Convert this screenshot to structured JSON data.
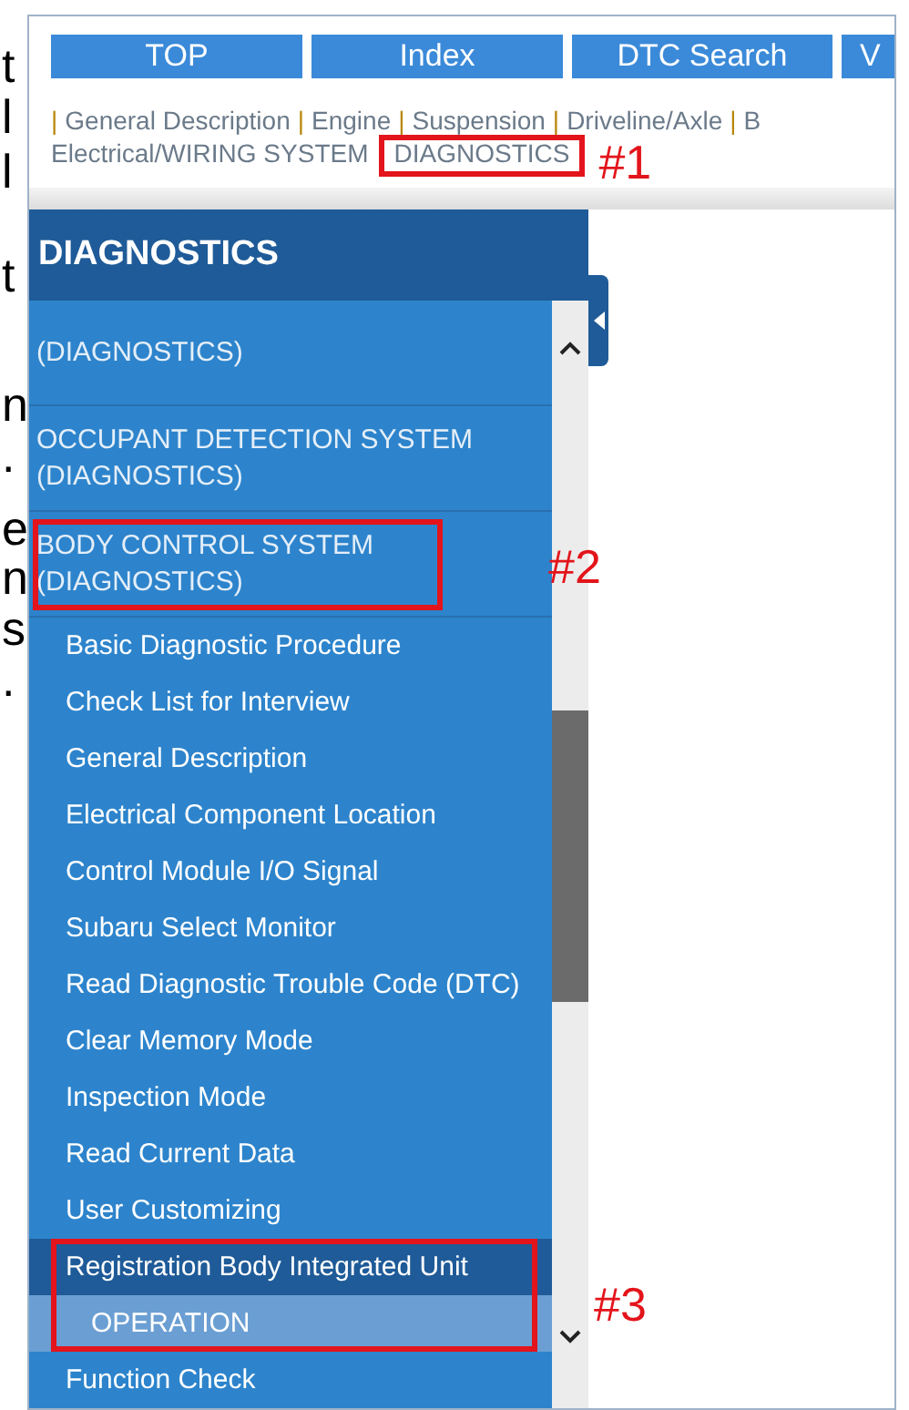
{
  "margin_text": [
    "t",
    "l",
    "l",
    "t",
    "n",
    ".",
    "e",
    "n",
    "s",
    "."
  ],
  "nav_tabs": [
    {
      "label": "TOP"
    },
    {
      "label": "Index"
    },
    {
      "label": "DTC Search"
    },
    {
      "label": "V"
    }
  ],
  "breadcrumb": {
    "lines": [
      {
        "separator": "|",
        "items": [
          {
            "label": "General Description"
          },
          {
            "label": "Engine"
          },
          {
            "label": "Suspension"
          },
          {
            "label": "Driveline/Axle"
          },
          {
            "label": "B"
          }
        ]
      },
      {
        "items": [
          {
            "label": "Electrical/WIRING SYSTEM"
          },
          {
            "label": "DIAGNOSTICS",
            "callout": "#1"
          }
        ]
      }
    ]
  },
  "sidebar": {
    "title": "DIAGNOSTICS",
    "items": [
      {
        "label": "(DIAGNOSTICS)",
        "kind": "section",
        "selected": false
      },
      {
        "label": "OCCUPANT DETECTION SYSTEM (DIAGNOSTICS)",
        "kind": "section",
        "selected": false
      },
      {
        "label": "BODY CONTROL SYSTEM (DIAGNOSTICS)",
        "kind": "section",
        "selected": false,
        "callout": "#2"
      },
      {
        "label": "Basic Diagnostic Procedure",
        "kind": "item",
        "selected": false
      },
      {
        "label": "Check List for Interview",
        "kind": "item",
        "selected": false
      },
      {
        "label": "General Description",
        "kind": "item",
        "selected": false
      },
      {
        "label": "Electrical Component Location",
        "kind": "item",
        "selected": false
      },
      {
        "label": "Control Module I/O Signal",
        "kind": "item",
        "selected": false
      },
      {
        "label": "Subaru Select Monitor",
        "kind": "item",
        "selected": false
      },
      {
        "label": "Read Diagnostic Trouble Code (DTC)",
        "kind": "item",
        "selected": false
      },
      {
        "label": "Clear Memory Mode",
        "kind": "item",
        "selected": false
      },
      {
        "label": "Inspection Mode",
        "kind": "item",
        "selected": false
      },
      {
        "label": "Read Current Data",
        "kind": "item",
        "selected": false
      },
      {
        "label": "User Customizing",
        "kind": "item",
        "selected": false
      },
      {
        "label": "Registration Body Integrated Unit",
        "kind": "group",
        "selected": false,
        "callout": "#3",
        "children": [
          {
            "label": "OPERATION",
            "kind": "subitem",
            "selected": true
          }
        ]
      },
      {
        "label": "Function Check",
        "kind": "item",
        "selected": false
      }
    ]
  }
}
